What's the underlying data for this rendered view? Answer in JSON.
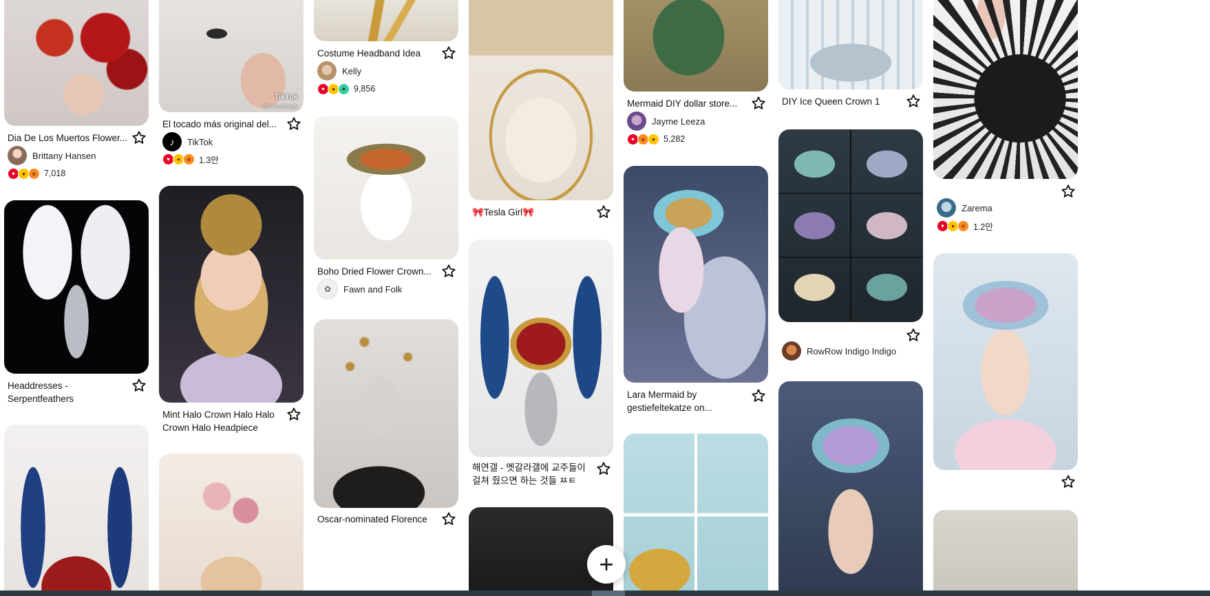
{
  "pins": [
    {
      "title": "Dia De Los Muertos Flower...",
      "author": "Brittany Hansen",
      "reactions": "7,018"
    },
    {
      "title": "El tocado más original del...",
      "author": "TikTok",
      "reactions": "1.3만"
    },
    {
      "title": "Costume Headband Idea",
      "author": "Kelly",
      "reactions": "9,856"
    },
    {
      "title": "Mermaid DIY dollar store...",
      "author": "Jayme Leeza",
      "reactions": "5,282"
    },
    {
      "title": "DIY Ice Queen Crown 1"
    },
    {
      "author": "Zarema",
      "reactions": "1.2만"
    },
    {
      "title": "Headdresses - Serpentfeathers"
    },
    {
      "title": "Mint Halo Crown Halo Halo Crown Halo Headpiece Halo..."
    },
    {
      "title": "Boho Dried Flower Crown...",
      "author": "Fawn and Folk"
    },
    {
      "title": "🎀Tesla Girl🎀"
    },
    {
      "title": "Lara Mermaid by gestiefeltekatze on..."
    },
    {
      "author": "RowRow Indigo Indigo"
    },
    {
      "title": "해연갤 - 멧갈라갤에 교주들이 걸쳐 줬으면 하는 것들 ㅉㅌ"
    },
    {
      "title": "Oscar-nominated Florence"
    }
  ],
  "watermark": "TikTok",
  "watermark_handle": "@nobodisugly",
  "fab_label": "+",
  "icons": {
    "save": "star-icon",
    "create": "plus-icon"
  }
}
